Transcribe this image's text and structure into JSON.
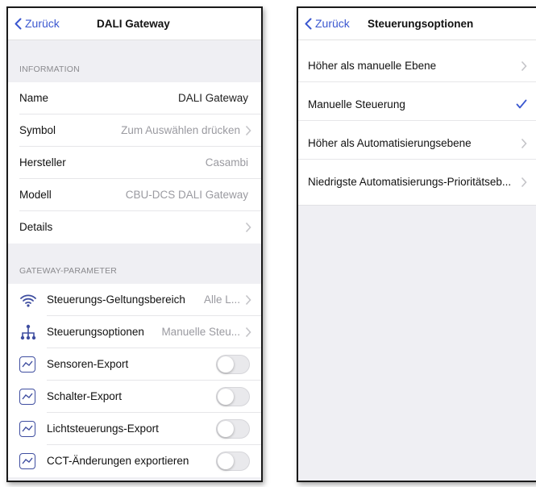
{
  "left_screen": {
    "back_label": "Zurück",
    "title": "DALI Gateway",
    "information_header": "INFORMATION",
    "info_rows": [
      {
        "label": "Name",
        "value": "DALI Gateway"
      },
      {
        "label": "Symbol",
        "value": "Zum Auswählen drücken"
      },
      {
        "label": "Hersteller",
        "value": "Casambi"
      },
      {
        "label": "Modell",
        "value": "CBU-DCS DALI Gateway"
      },
      {
        "label": "Details",
        "value": ""
      }
    ],
    "gateway_header": "GATEWAY-PARAMETER",
    "gateway_rows": [
      {
        "label": "Steuerungs-Geltungsbereich",
        "value": "Alle L...",
        "icon": "wifi-icon"
      },
      {
        "label": "Steuerungsoptionen",
        "value": "Manuelle Steu...",
        "icon": "hierarchy-icon"
      }
    ],
    "toggle_rows": [
      {
        "label": "Sensoren-Export",
        "on": false,
        "icon": "chart-line-icon"
      },
      {
        "label": "Schalter-Export",
        "on": false,
        "icon": "chart-line-icon"
      },
      {
        "label": "Lichtsteuerungs-Export",
        "on": false,
        "icon": "chart-line-icon"
      },
      {
        "label": "CCT-Änderungen exportieren",
        "on": false,
        "icon": "chart-line-icon"
      }
    ]
  },
  "right_screen": {
    "back_label": "Zurück",
    "title": "Steuerungsoptionen",
    "options": [
      {
        "label": "Höher als manuelle Ebene",
        "selected": false
      },
      {
        "label": "Manuelle Steuerung",
        "selected": true
      },
      {
        "label": "Höher als Automatisierungsebene",
        "selected": false
      },
      {
        "label": "Niedrigste Automatisierungs-Prioritätseb...",
        "selected": false
      }
    ]
  },
  "colors": {
    "accent": "#3a57d0",
    "icon": "#3f4ea0",
    "grouped_background": "#efeff3",
    "secondary_text": "#9a9aa0"
  }
}
